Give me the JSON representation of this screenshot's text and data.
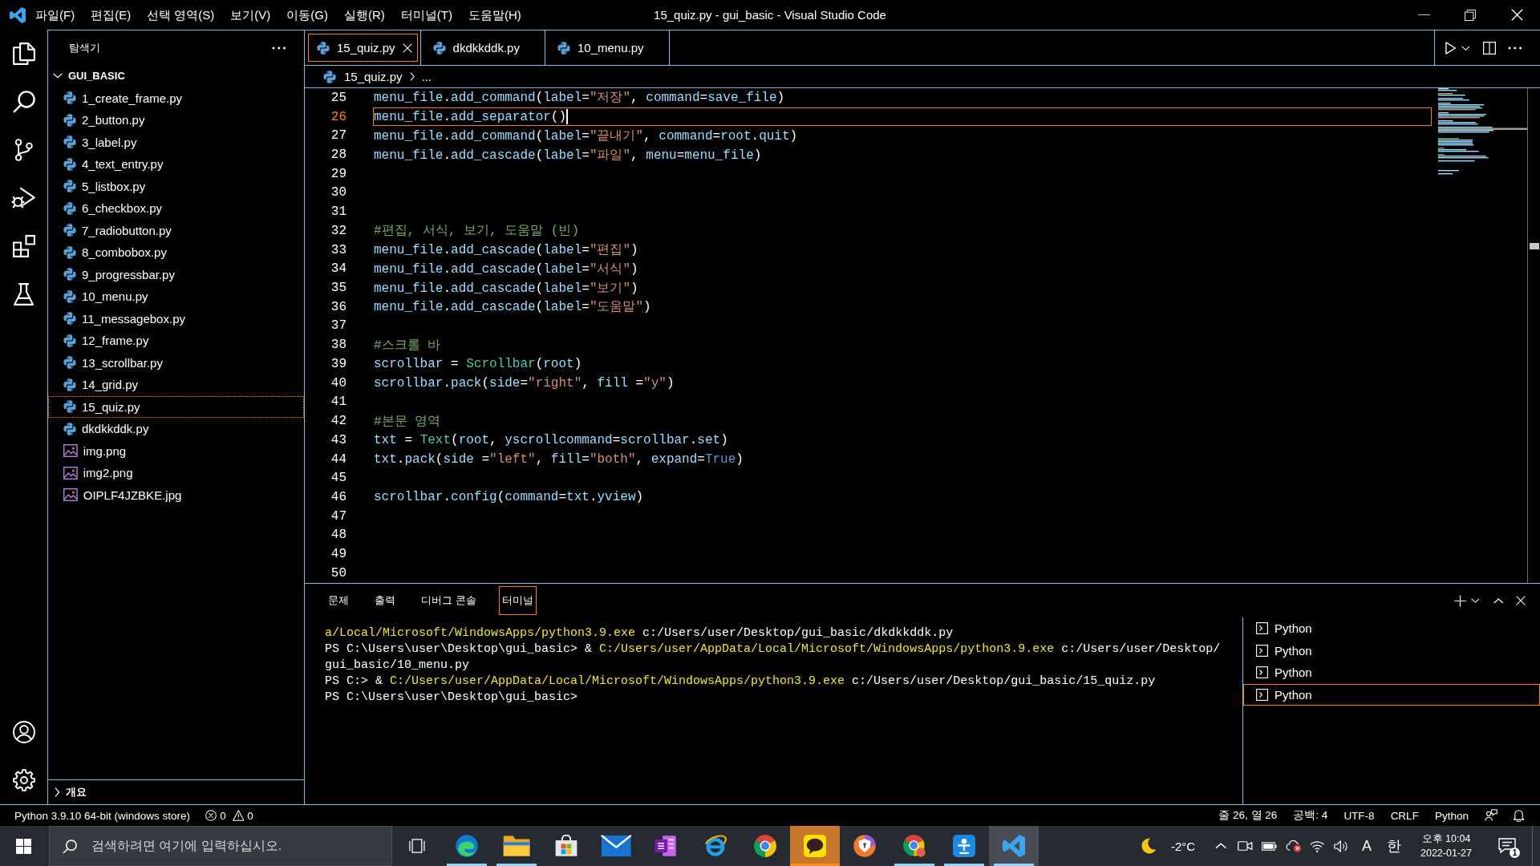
{
  "title_bar": {
    "menus": [
      "파일(F)",
      "편집(E)",
      "선택 영역(S)",
      "보기(V)",
      "이동(G)",
      "실행(R)",
      "터미널(T)",
      "도움말(H)"
    ],
    "title": "15_quiz.py - gui_basic - Visual Studio Code"
  },
  "sidebar": {
    "title": "탐색기",
    "folder": {
      "name": "GUI_BASIC",
      "expanded": true,
      "files": [
        {
          "name": "1_create_frame.py",
          "kind": "python",
          "selected": false
        },
        {
          "name": "2_button.py",
          "kind": "python",
          "selected": false
        },
        {
          "name": "3_label.py",
          "kind": "python",
          "selected": false
        },
        {
          "name": "4_text_entry.py",
          "kind": "python",
          "selected": false
        },
        {
          "name": "5_listbox.py",
          "kind": "python",
          "selected": false
        },
        {
          "name": "6_checkbox.py",
          "kind": "python",
          "selected": false
        },
        {
          "name": "7_radiobutton.py",
          "kind": "python",
          "selected": false
        },
        {
          "name": "8_combobox.py",
          "kind": "python",
          "selected": false
        },
        {
          "name": "9_progressbar.py",
          "kind": "python",
          "selected": false
        },
        {
          "name": "10_menu.py",
          "kind": "python",
          "selected": false
        },
        {
          "name": "11_messagebox.py",
          "kind": "python",
          "selected": false
        },
        {
          "name": "12_frame.py",
          "kind": "python",
          "selected": false
        },
        {
          "name": "13_scrollbar.py",
          "kind": "python",
          "selected": false
        },
        {
          "name": "14_grid.py",
          "kind": "python",
          "selected": false
        },
        {
          "name": "15_quiz.py",
          "kind": "python",
          "selected": true
        },
        {
          "name": "dkdkkddk.py",
          "kind": "python",
          "selected": false
        },
        {
          "name": "img.png",
          "kind": "image",
          "selected": false
        },
        {
          "name": "img2.png",
          "kind": "image",
          "selected": false
        },
        {
          "name": "OIPLF4JZBKE.jpg",
          "kind": "image",
          "selected": false
        }
      ]
    },
    "outline": {
      "label": "개요",
      "expanded": false
    }
  },
  "editor": {
    "tabs": [
      {
        "label": "15_quiz.py",
        "selected": true
      },
      {
        "label": "dkdkkddk.py",
        "selected": false
      },
      {
        "label": "10_menu.py",
        "selected": false
      }
    ],
    "breadcrumb": {
      "file": "15_quiz.py",
      "symbol": "..."
    },
    "lines": [
      {
        "number": "25",
        "current": false,
        "tokens": [
          {
            "kind": "name",
            "text": "menu_file"
          },
          {
            "kind": "plain",
            "text": "."
          },
          {
            "kind": "name",
            "text": "add_command"
          },
          {
            "kind": "plain",
            "text": "("
          },
          {
            "kind": "name",
            "text": "label"
          },
          {
            "kind": "plain",
            "text": "="
          },
          {
            "kind": "string",
            "text": "\"저장\""
          },
          {
            "kind": "plain",
            "text": ", "
          },
          {
            "kind": "name",
            "text": "command"
          },
          {
            "kind": "plain",
            "text": "="
          },
          {
            "kind": "name",
            "text": "save_file"
          },
          {
            "kind": "plain",
            "text": ")"
          }
        ]
      },
      {
        "number": "26",
        "current": true,
        "tokens": [
          {
            "kind": "name",
            "text": "menu_file"
          },
          {
            "kind": "plain",
            "text": "."
          },
          {
            "kind": "name",
            "text": "add_separator"
          },
          {
            "kind": "plain",
            "text": "()"
          }
        ]
      },
      {
        "number": "27",
        "current": false,
        "tokens": [
          {
            "kind": "name",
            "text": "menu_file"
          },
          {
            "kind": "plain",
            "text": "."
          },
          {
            "kind": "name",
            "text": "add_command"
          },
          {
            "kind": "plain",
            "text": "("
          },
          {
            "kind": "name",
            "text": "label"
          },
          {
            "kind": "plain",
            "text": "="
          },
          {
            "kind": "string",
            "text": "\"끝내기\""
          },
          {
            "kind": "plain",
            "text": ", "
          },
          {
            "kind": "name",
            "text": "command"
          },
          {
            "kind": "plain",
            "text": "="
          },
          {
            "kind": "name",
            "text": "root"
          },
          {
            "kind": "plain",
            "text": "."
          },
          {
            "kind": "name",
            "text": "quit"
          },
          {
            "kind": "plain",
            "text": ")"
          }
        ]
      },
      {
        "number": "28",
        "current": false,
        "tokens": [
          {
            "kind": "name",
            "text": "menu_file"
          },
          {
            "kind": "plain",
            "text": "."
          },
          {
            "kind": "name",
            "text": "add_cascade"
          },
          {
            "kind": "plain",
            "text": "("
          },
          {
            "kind": "name",
            "text": "label"
          },
          {
            "kind": "plain",
            "text": "="
          },
          {
            "kind": "string",
            "text": "\"파일\""
          },
          {
            "kind": "plain",
            "text": ", "
          },
          {
            "kind": "name",
            "text": "menu"
          },
          {
            "kind": "plain",
            "text": "="
          },
          {
            "kind": "name",
            "text": "menu_file"
          },
          {
            "kind": "plain",
            "text": ")"
          }
        ]
      },
      {
        "number": "29",
        "current": false
      },
      {
        "number": "30",
        "current": false
      },
      {
        "number": "31",
        "current": false
      },
      {
        "number": "32",
        "current": false,
        "tokens": [
          {
            "kind": "comment",
            "text": "#편집, 서식, 보기, 도움말 (빈)"
          }
        ]
      },
      {
        "number": "33",
        "current": false,
        "tokens": [
          {
            "kind": "name",
            "text": "menu_file"
          },
          {
            "kind": "plain",
            "text": "."
          },
          {
            "kind": "name",
            "text": "add_cascade"
          },
          {
            "kind": "plain",
            "text": "("
          },
          {
            "kind": "name",
            "text": "label"
          },
          {
            "kind": "plain",
            "text": "="
          },
          {
            "kind": "string",
            "text": "\"편집\""
          },
          {
            "kind": "plain",
            "text": ")"
          }
        ]
      },
      {
        "number": "34",
        "current": false,
        "tokens": [
          {
            "kind": "name",
            "text": "menu_file"
          },
          {
            "kind": "plain",
            "text": "."
          },
          {
            "kind": "name",
            "text": "add_cascade"
          },
          {
            "kind": "plain",
            "text": "("
          },
          {
            "kind": "name",
            "text": "label"
          },
          {
            "kind": "plain",
            "text": "="
          },
          {
            "kind": "string",
            "text": "\"서식\""
          },
          {
            "kind": "plain",
            "text": ")"
          }
        ]
      },
      {
        "number": "35",
        "current": false,
        "tokens": [
          {
            "kind": "name",
            "text": "menu_file"
          },
          {
            "kind": "plain",
            "text": "."
          },
          {
            "kind": "name",
            "text": "add_cascade"
          },
          {
            "kind": "plain",
            "text": "("
          },
          {
            "kind": "name",
            "text": "label"
          },
          {
            "kind": "plain",
            "text": "="
          },
          {
            "kind": "string",
            "text": "\"보기\""
          },
          {
            "kind": "plain",
            "text": ")"
          }
        ]
      },
      {
        "number": "36",
        "current": false,
        "tokens": [
          {
            "kind": "name",
            "text": "menu_file"
          },
          {
            "kind": "plain",
            "text": "."
          },
          {
            "kind": "name",
            "text": "add_cascade"
          },
          {
            "kind": "plain",
            "text": "("
          },
          {
            "kind": "name",
            "text": "label"
          },
          {
            "kind": "plain",
            "text": "="
          },
          {
            "kind": "string",
            "text": "\"도움말\""
          },
          {
            "kind": "plain",
            "text": ")"
          }
        ]
      },
      {
        "number": "37",
        "current": false
      },
      {
        "number": "38",
        "current": false,
        "tokens": [
          {
            "kind": "comment",
            "text": "#스크롤 바"
          }
        ]
      },
      {
        "number": "39",
        "current": false,
        "tokens": [
          {
            "kind": "name",
            "text": "scrollbar"
          },
          {
            "kind": "plain",
            "text": " = "
          },
          {
            "kind": "class",
            "text": "Scrollbar"
          },
          {
            "kind": "plain",
            "text": "("
          },
          {
            "kind": "name",
            "text": "root"
          },
          {
            "kind": "plain",
            "text": ")"
          }
        ]
      },
      {
        "number": "40",
        "current": false,
        "tokens": [
          {
            "kind": "name",
            "text": "scrollbar"
          },
          {
            "kind": "plain",
            "text": "."
          },
          {
            "kind": "name",
            "text": "pack"
          },
          {
            "kind": "plain",
            "text": "("
          },
          {
            "kind": "name",
            "text": "side"
          },
          {
            "kind": "plain",
            "text": "="
          },
          {
            "kind": "string",
            "text": "\"right\""
          },
          {
            "kind": "plain",
            "text": ", "
          },
          {
            "kind": "name",
            "text": "fill"
          },
          {
            "kind": "plain",
            "text": " ="
          },
          {
            "kind": "string",
            "text": "\"y\""
          },
          {
            "kind": "plain",
            "text": ")"
          }
        ]
      },
      {
        "number": "41",
        "current": false
      },
      {
        "number": "42",
        "current": false,
        "tokens": [
          {
            "kind": "comment",
            "text": "#본문 영역"
          }
        ]
      },
      {
        "number": "43",
        "current": false,
        "tokens": [
          {
            "kind": "name",
            "text": "txt"
          },
          {
            "kind": "plain",
            "text": " = "
          },
          {
            "kind": "class",
            "text": "Text"
          },
          {
            "kind": "plain",
            "text": "("
          },
          {
            "kind": "name",
            "text": "root"
          },
          {
            "kind": "plain",
            "text": ", "
          },
          {
            "kind": "name",
            "text": "yscrollcommand"
          },
          {
            "kind": "plain",
            "text": "="
          },
          {
            "kind": "name",
            "text": "scrollbar"
          },
          {
            "kind": "plain",
            "text": "."
          },
          {
            "kind": "name",
            "text": "set"
          },
          {
            "kind": "plain",
            "text": ")"
          }
        ]
      },
      {
        "number": "44",
        "current": false,
        "tokens": [
          {
            "kind": "name",
            "text": "txt"
          },
          {
            "kind": "plain",
            "text": "."
          },
          {
            "kind": "name",
            "text": "pack"
          },
          {
            "kind": "plain",
            "text": "("
          },
          {
            "kind": "name",
            "text": "side"
          },
          {
            "kind": "plain",
            "text": " ="
          },
          {
            "kind": "string",
            "text": "\"left\""
          },
          {
            "kind": "plain",
            "text": ", "
          },
          {
            "kind": "name",
            "text": "fill"
          },
          {
            "kind": "plain",
            "text": "="
          },
          {
            "kind": "string",
            "text": "\"both\""
          },
          {
            "kind": "plain",
            "text": ", "
          },
          {
            "kind": "name",
            "text": "expand"
          },
          {
            "kind": "plain",
            "text": "="
          },
          {
            "kind": "const",
            "text": "True"
          },
          {
            "kind": "plain",
            "text": ")"
          }
        ]
      },
      {
        "number": "45",
        "current": false
      },
      {
        "number": "46",
        "current": false,
        "tokens": [
          {
            "kind": "name",
            "text": "scrollbar"
          },
          {
            "kind": "plain",
            "text": "."
          },
          {
            "kind": "name",
            "text": "config"
          },
          {
            "kind": "plain",
            "text": "("
          },
          {
            "kind": "name",
            "text": "command"
          },
          {
            "kind": "plain",
            "text": "="
          },
          {
            "kind": "name",
            "text": "txt"
          },
          {
            "kind": "plain",
            "text": "."
          },
          {
            "kind": "name",
            "text": "yview"
          },
          {
            "kind": "plain",
            "text": ")"
          }
        ]
      },
      {
        "number": "47",
        "current": false
      },
      {
        "number": "48",
        "current": false
      },
      {
        "number": "49",
        "current": false
      },
      {
        "number": "50",
        "current": false
      }
    ]
  },
  "panel": {
    "tabs": [
      {
        "label": "문제",
        "selected": false
      },
      {
        "label": "출력",
        "selected": false
      },
      {
        "label": "디버그 콘솔",
        "selected": false
      },
      {
        "label": "터미널",
        "selected": true
      }
    ],
    "terminal_lines": [
      {
        "segments": [
          {
            "kind": "path",
            "text": "a/Local/Microsoft/WindowsApps/python3.9.exe"
          },
          {
            "kind": "plain",
            "text": " c:/Users/user/Desktop/gui_basic/dkdkkddk.py"
          }
        ]
      },
      {
        "segments": [
          {
            "kind": "plain",
            "text": "PS C:\\Users\\user\\Desktop\\gui_basic> & "
          },
          {
            "kind": "path",
            "text": "C:/Users/user/AppData/Local/Microsoft/WindowsApps/python3.9.exe"
          },
          {
            "kind": "plain",
            "text": " c:/Users/user/Desktop/"
          }
        ]
      },
      {
        "segments": [
          {
            "kind": "plain",
            "text": "gui_basic/10_menu.py"
          }
        ]
      },
      {
        "segments": [
          {
            "kind": "plain",
            "text": "PS C:> & "
          },
          {
            "kind": "path",
            "text": "C:/Users/user/AppData/Local/Microsoft/WindowsApps/python3.9.exe"
          },
          {
            "kind": "plain",
            "text": " c:/Users/user/Desktop/gui_basic/15_quiz.py"
          }
        ]
      },
      {
        "segments": [
          {
            "kind": "plain",
            "text": "PS C:\\Users\\user\\Desktop\\gui_basic>"
          }
        ]
      }
    ],
    "terminals": [
      {
        "label": "Python",
        "selected": false
      },
      {
        "label": "Python",
        "selected": false
      },
      {
        "label": "Python",
        "selected": false
      },
      {
        "label": "Python",
        "selected": true
      }
    ]
  },
  "status_bar": {
    "interpreter": "Python 3.9.10 64-bit (windows store)",
    "errors": "0",
    "warnings": "0",
    "cursor_position": "줄 26, 열 26",
    "indentation": "공백: 4",
    "encoding": "UTF-8",
    "line_ending": "CRLF",
    "language": "Python"
  },
  "taskbar": {
    "search": {
      "placeholder": "검색하려면 여기에 입력하십시오."
    },
    "apps": [
      {
        "kind": "edge",
        "running": true,
        "active": false,
        "flashing": false
      },
      {
        "kind": "folder",
        "running": true,
        "active": false,
        "flashing": false
      },
      {
        "kind": "store",
        "running": false,
        "active": false,
        "flashing": false
      },
      {
        "kind": "mail",
        "running": false,
        "active": false,
        "flashing": false
      },
      {
        "kind": "onenote",
        "running": false,
        "active": false,
        "flashing": false
      },
      {
        "kind": "ie",
        "running": false,
        "active": false,
        "flashing": false
      },
      {
        "kind": "chrome",
        "running": false,
        "active": false,
        "flashing": false
      },
      {
        "kind": "kakao",
        "running": true,
        "active": false,
        "flashing": true
      },
      {
        "kind": "shield",
        "running": false,
        "active": false,
        "flashing": false
      },
      {
        "kind": "chrome-profile",
        "running": true,
        "active": false,
        "flashing": false
      },
      {
        "kind": "tile",
        "running": true,
        "active": false,
        "flashing": false
      },
      {
        "kind": "vscode",
        "running": true,
        "active": true,
        "flashing": false
      }
    ],
    "weather": "-2°C",
    "input_mode": "A",
    "input_language": "한",
    "time": "오후 10:04",
    "date": "2022-01-27",
    "notification_count": "1"
  }
}
